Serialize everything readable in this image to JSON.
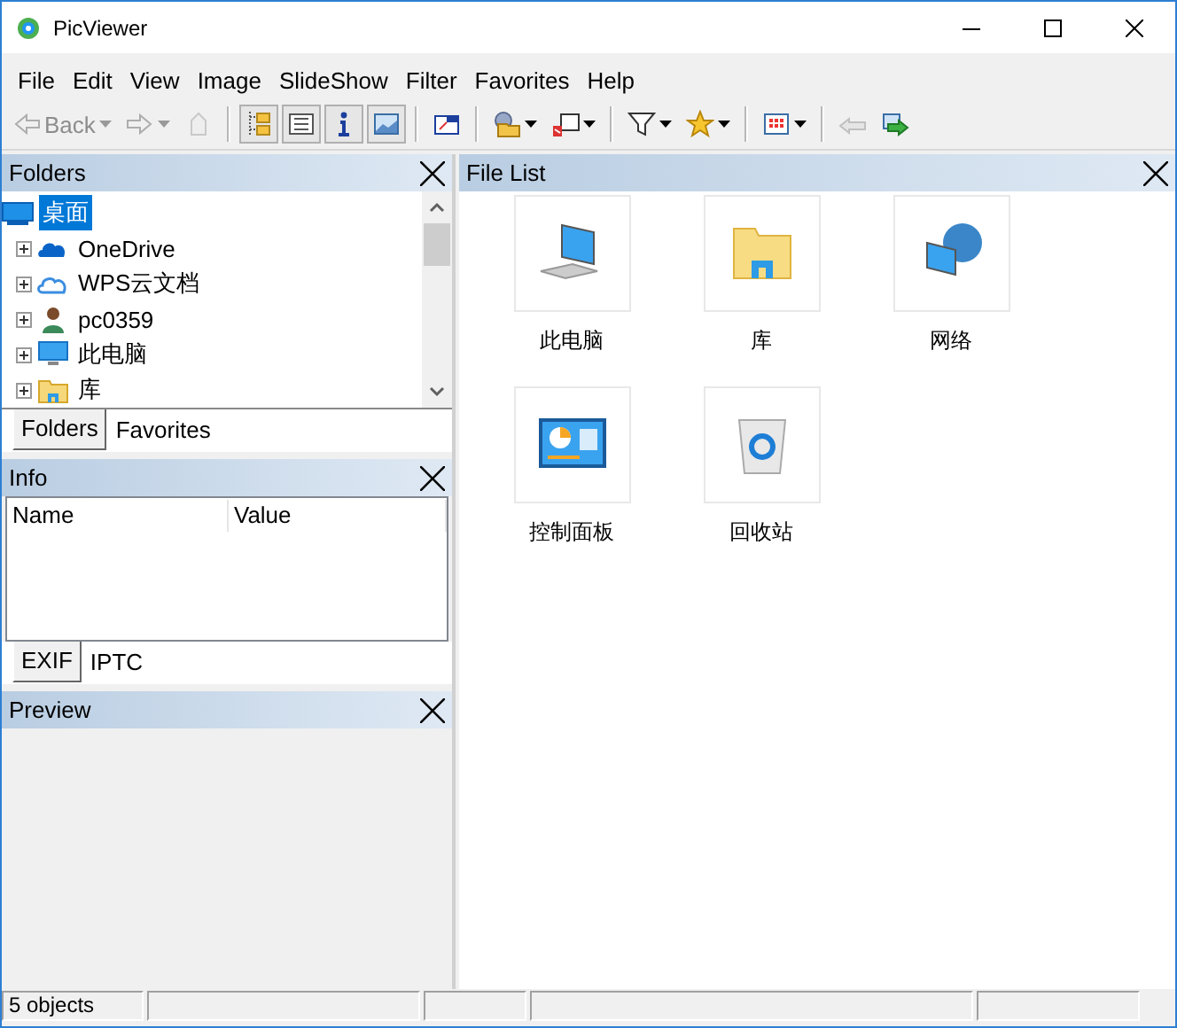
{
  "window": {
    "title": "PicViewer"
  },
  "menu": [
    "File",
    "Edit",
    "View",
    "Image",
    "SlideShow",
    "Filter",
    "Favorites",
    "Help"
  ],
  "toolbar": [
    {
      "kind": "back",
      "label": "Back",
      "dropdown": true,
      "disabled": true,
      "pressed": false
    },
    {
      "kind": "forward",
      "dropdown": true,
      "disabled": true,
      "pressed": false
    },
    {
      "kind": "up",
      "dropdown": false,
      "disabled": true,
      "pressed": false
    },
    {
      "kind": "separator"
    },
    {
      "kind": "tree",
      "dropdown": false,
      "disabled": false,
      "pressed": true
    },
    {
      "kind": "list",
      "dropdown": false,
      "disabled": false,
      "pressed": true
    },
    {
      "kind": "info",
      "dropdown": false,
      "disabled": false,
      "pressed": true
    },
    {
      "kind": "preview",
      "dropdown": false,
      "disabled": false,
      "pressed": true
    },
    {
      "kind": "separator"
    },
    {
      "kind": "fullscreen",
      "dropdown": false,
      "disabled": false,
      "pressed": false
    },
    {
      "kind": "separator"
    },
    {
      "kind": "folder",
      "dropdown": true,
      "disabled": false,
      "pressed": false
    },
    {
      "kind": "copy",
      "dropdown": true,
      "disabled": false,
      "pressed": false
    },
    {
      "kind": "separator"
    },
    {
      "kind": "filter",
      "dropdown": true,
      "disabled": false,
      "pressed": false
    },
    {
      "kind": "star",
      "dropdown": true,
      "disabled": false,
      "pressed": false
    },
    {
      "kind": "separator"
    },
    {
      "kind": "grid",
      "dropdown": true,
      "disabled": false,
      "pressed": false
    },
    {
      "kind": "separator"
    },
    {
      "kind": "prev",
      "dropdown": false,
      "disabled": true,
      "pressed": false
    },
    {
      "kind": "next",
      "dropdown": false,
      "disabled": false,
      "pressed": false
    }
  ],
  "folders_panel": {
    "title": "Folders",
    "tree": [
      {
        "label": "桌面",
        "kind": "desktop",
        "selected": true,
        "expanded": true,
        "children": [
          {
            "label": "OneDrive",
            "kind": "onedrive",
            "selected": false,
            "expanded": false
          },
          {
            "label": "WPS云文档",
            "kind": "cloud",
            "selected": false,
            "expanded": false
          },
          {
            "label": "pc0359",
            "kind": "user",
            "selected": false,
            "expanded": false
          },
          {
            "label": "此电脑",
            "kind": "computer",
            "selected": false,
            "expanded": false
          },
          {
            "label": "库",
            "kind": "library",
            "selected": false,
            "expanded": false
          }
        ]
      }
    ],
    "tabs": [
      {
        "label": "Folders",
        "selected": true
      },
      {
        "label": "Favorites",
        "selected": false
      }
    ]
  },
  "info_panel": {
    "title": "Info",
    "columns": [
      "Name",
      "Value"
    ],
    "tabs": [
      {
        "label": "EXIF",
        "selected": true
      },
      {
        "label": "IPTC",
        "selected": false
      }
    ]
  },
  "preview_panel": {
    "title": "Preview"
  },
  "file_list": {
    "title": "File List",
    "items": [
      {
        "label": "此电脑",
        "kind": "computer"
      },
      {
        "label": "库",
        "kind": "library"
      },
      {
        "label": "网络",
        "kind": "network"
      },
      {
        "label": "控制面板",
        "kind": "control-panel"
      },
      {
        "label": "回收站",
        "kind": "recycle-bin"
      }
    ]
  },
  "status_bar": [
    "5 objects"
  ]
}
